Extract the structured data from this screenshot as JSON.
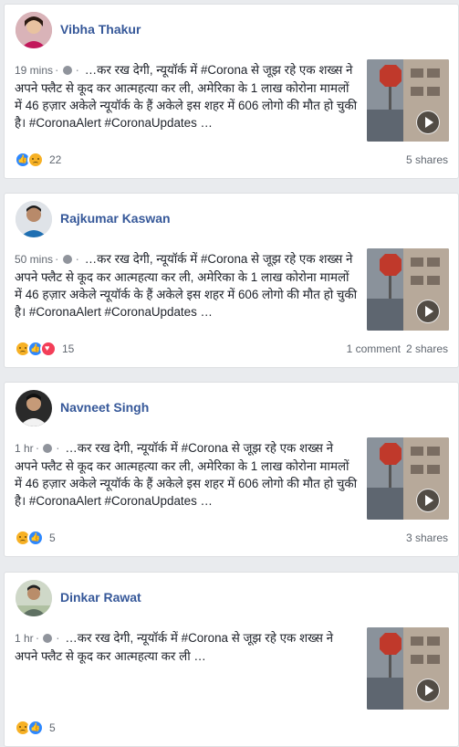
{
  "posts": [
    {
      "author": "Vibha Thakur",
      "time": "19 mins",
      "text": "…कर रख देगी, न्यूयॉर्क में #Corona से जूझ रहे एक शख्स ने अपने फ्लैट से कूद कर आत्महत्या कर ली, अमेरिका के 1 लाख कोरोना मामलों में 46 हज़ार अकेले न्यूयॉर्क के हैं अकेले इस शहर में 606 लोगो की मौत हो चुकी है। #CoronaAlert #CoronaUpdates …",
      "reactions": [
        "like",
        "sad"
      ],
      "reaction_count": "22",
      "comments": "",
      "shares": "5 shares"
    },
    {
      "author": "Rajkumar Kaswan",
      "time": "50 mins",
      "text": "…कर रख देगी, न्यूयॉर्क में #Corona से जूझ रहे एक शख्स ने अपने फ्लैट से कूद कर आत्महत्या कर ली, अमेरिका के 1 लाख कोरोना मामलों में 46 हज़ार अकेले न्यूयॉर्क के हैं अकेले इस शहर में 606 लोगो की मौत हो चुकी है। #CoronaAlert #CoronaUpdates …",
      "reactions": [
        "sad",
        "like",
        "love"
      ],
      "reaction_count": "15",
      "comments": "1 comment",
      "shares": "2 shares"
    },
    {
      "author": "Navneet Singh",
      "time": "1 hr",
      "text": "…कर रख देगी, न्यूयॉर्क में #Corona से जूझ रहे एक शख्स ने अपने फ्लैट से कूद कर आत्महत्या कर ली, अमेरिका के 1 लाख कोरोना मामलों में 46 हज़ार अकेले न्यूयॉर्क के हैं अकेले इस शहर में 606 लोगो की मौत हो चुकी है। #CoronaAlert #CoronaUpdates …",
      "reactions": [
        "sad",
        "like"
      ],
      "reaction_count": "5",
      "comments": "",
      "shares": "3 shares"
    },
    {
      "author": "Dinkar Rawat",
      "time": "1 hr",
      "text": "…कर रख देगी, न्यूयॉर्क में #Corona से जूझ रहे एक शख्स ने अपने फ्लैट से कूद कर आत्महत्या कर ली …",
      "reactions": [
        "sad",
        "like"
      ],
      "reaction_count": "5",
      "comments": "",
      "shares": ""
    }
  ],
  "colors": {
    "author": "#365899",
    "background": "#e9ebee",
    "like": "#2d88ff",
    "sad": "#f7b125",
    "love": "#f33e58"
  },
  "icons": {
    "privacy": "globe-icon",
    "video": "play-icon"
  }
}
